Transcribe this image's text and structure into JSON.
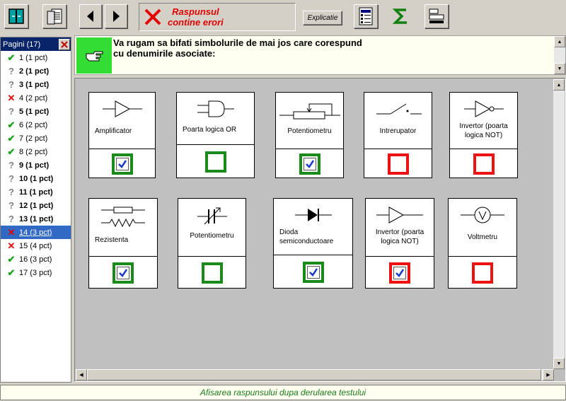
{
  "toolbar": {
    "status_line1": "Raspunsul",
    "status_line2": "contine erori",
    "explain_label": "Explicatie"
  },
  "pages": {
    "header": "Pagini (17)",
    "items": [
      {
        "label": "1 (1 pct)",
        "mark": "ok",
        "bold": false
      },
      {
        "label": "2 (1 pct)",
        "mark": "q",
        "bold": true
      },
      {
        "label": "3 (1 pct)",
        "mark": "q",
        "bold": true
      },
      {
        "label": "4 (2 pct)",
        "mark": "x",
        "bold": false
      },
      {
        "label": "5 (1 pct)",
        "mark": "q",
        "bold": true
      },
      {
        "label": "6 (2 pct)",
        "mark": "ok",
        "bold": false
      },
      {
        "label": "7 (2 pct)",
        "mark": "ok",
        "bold": false
      },
      {
        "label": "8 (2 pct)",
        "mark": "ok",
        "bold": false
      },
      {
        "label": "9 (1 pct)",
        "mark": "q",
        "bold": true
      },
      {
        "label": "10 (1 pct)",
        "mark": "q",
        "bold": true
      },
      {
        "label": "11 (1 pct)",
        "mark": "q",
        "bold": true
      },
      {
        "label": "12 (1 pct)",
        "mark": "q",
        "bold": true
      },
      {
        "label": "13 (1 pct)",
        "mark": "q",
        "bold": true
      },
      {
        "label": "14 (3 pct)",
        "mark": "x",
        "bold": false,
        "selected": true
      },
      {
        "label": "15 (4 pct)",
        "mark": "x",
        "bold": false
      },
      {
        "label": "16 (3 pct)",
        "mark": "ok",
        "bold": false
      },
      {
        "label": "17 (3 pct)",
        "mark": "ok",
        "bold": false
      }
    ]
  },
  "question": {
    "line1": "Va rugam sa bifati simbolurile de mai jos care corespund",
    "line2": "cu denumirile asociate:"
  },
  "cards": [
    {
      "label": "Amplificator",
      "symbol": "amplifier",
      "checked": true,
      "status": "green"
    },
    {
      "label": "Poarta logica OR",
      "symbol": "or-gate",
      "checked": false,
      "status": "green"
    },
    {
      "label": "Potentiometru",
      "symbol": "potentiometer",
      "checked": true,
      "status": "green"
    },
    {
      "label": "Intrerupator",
      "symbol": "switch",
      "checked": false,
      "status": "red"
    },
    {
      "label": "Invertor (poarta logica NOT)",
      "symbol": "not-gate",
      "checked": false,
      "status": "red"
    },
    {
      "label": "Rezistenta",
      "symbol": "resistor",
      "checked": true,
      "status": "green"
    },
    {
      "label": "Potentiometru",
      "symbol": "variable-capacitor",
      "checked": false,
      "status": "green"
    },
    {
      "label": "Dioda semiconductoare",
      "symbol": "diode",
      "checked": true,
      "status": "green"
    },
    {
      "label": "Invertor (poarta logica NOT)",
      "symbol": "buffer",
      "checked": true,
      "status": "red"
    },
    {
      "label": "Voltmetru",
      "symbol": "voltmeter",
      "checked": false,
      "status": "red"
    }
  ],
  "footer": {
    "text": "Afisarea raspunsului dupa derularea testului"
  },
  "colors": {
    "ok": "#1aa31a",
    "error": "#e00000",
    "selection": "#316ac5",
    "question_icon": "#33dd33"
  }
}
